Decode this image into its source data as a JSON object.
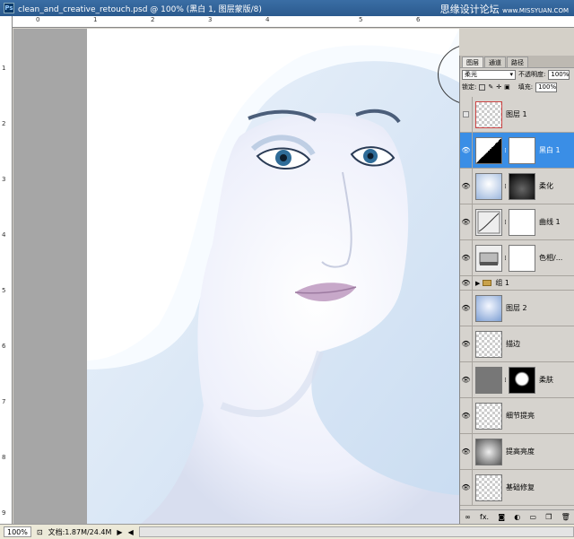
{
  "window": {
    "title": "clean_and_creative_retouch.psd @ 100% (黑白 1, 图层蒙版/8)",
    "watermark": "思缘设计论坛",
    "watermark_url": "www.MISSYUAN.COM"
  },
  "ruler_top": [
    "0",
    "1",
    "2",
    "3",
    "4",
    "5",
    "6"
  ],
  "ruler_left": [
    "1",
    "2",
    "3",
    "4",
    "5",
    "6",
    "7",
    "8",
    "9"
  ],
  "status": {
    "zoom": "100%",
    "doc": "文档:1.87M/24.4M"
  },
  "panel": {
    "tabs": [
      "图层",
      "通道",
      "路径"
    ],
    "blend_mode": "柔光",
    "opacity_label": "不透明度:",
    "opacity": "100%",
    "lock_label": "锁定:",
    "fill_label": "填充:",
    "fill": "100%",
    "layers": [
      {
        "name": "图层 1",
        "kind": "pattern"
      },
      {
        "name": "黑白 1",
        "kind": "adjust-bw",
        "selected": true
      },
      {
        "name": "柔化",
        "kind": "photo-mask"
      },
      {
        "name": "曲线 1",
        "kind": "curves"
      },
      {
        "name": "色相/...",
        "kind": "hue"
      },
      {
        "name": "组 1",
        "kind": "group"
      },
      {
        "name": "图层 2",
        "kind": "photo"
      },
      {
        "name": "描边",
        "kind": "empty"
      },
      {
        "name": "柔肤",
        "kind": "gray-mask"
      },
      {
        "name": "细节提亮",
        "kind": "empty"
      },
      {
        "name": "提高亮度",
        "kind": "blurgray"
      },
      {
        "name": "基础修复",
        "kind": "empty"
      }
    ]
  },
  "icons": {
    "eye": "eye-icon",
    "link": "link-icon",
    "folder": "folder-icon"
  }
}
